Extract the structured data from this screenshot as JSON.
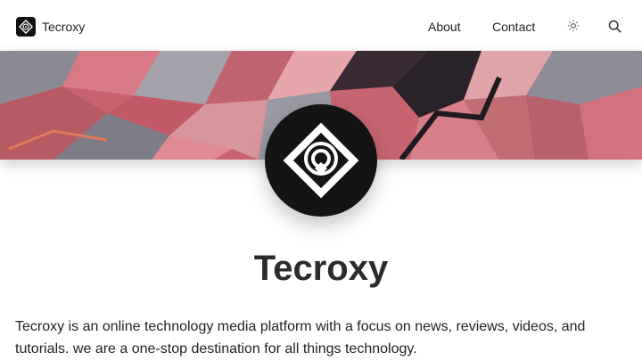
{
  "header": {
    "site_name": "Tecroxy",
    "nav": [
      {
        "label": "About"
      },
      {
        "label": "Contact"
      }
    ],
    "theme_toggle_icon": "sun-icon",
    "search_icon": "search-icon"
  },
  "profile": {
    "title": "Tecroxy",
    "description": "Tecroxy is an online technology media platform with a focus on news, reviews, videos, and tutorials. we are a one-stop destination for all things technology."
  },
  "colors": {
    "cover_primary": "#c9646e",
    "cover_dark": "#3a2a33",
    "logo_bg": "#141414"
  }
}
